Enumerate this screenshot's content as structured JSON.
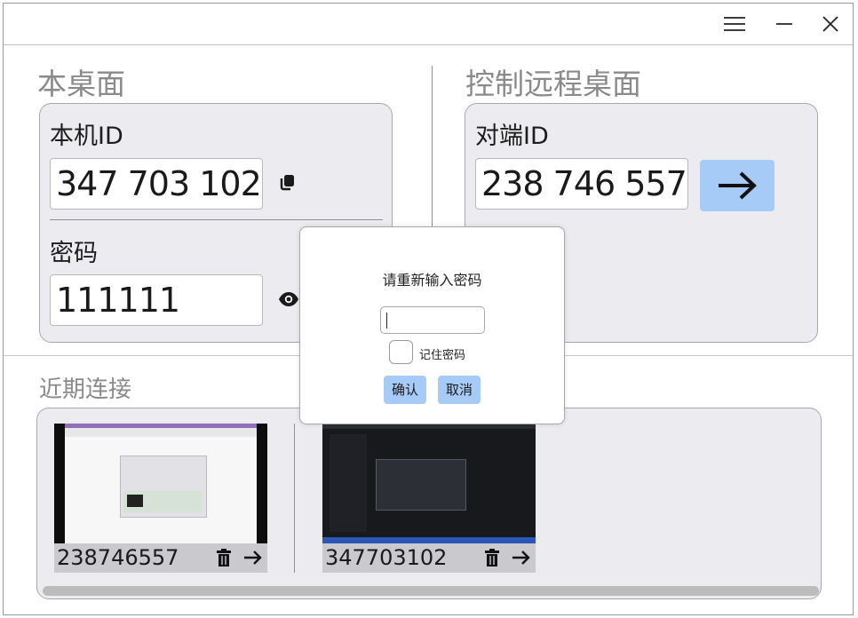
{
  "titlebar": {
    "menu_icon": "hamburger-menu-icon",
    "minimize_icon": "minimize-icon",
    "close_icon": "close-icon"
  },
  "local": {
    "section_title": "本桌面",
    "id_label": "本机ID",
    "id_value": "347 703 102",
    "copy_icon": "copy-icon",
    "password_label": "密码",
    "password_value": "111111",
    "eye_icon": "eye-icon"
  },
  "remote": {
    "section_title": "控制远程桌面",
    "id_label": "对端ID",
    "id_value": "238 746 557",
    "connect_icon": "arrow-right-icon"
  },
  "recent": {
    "section_title": "近期连接",
    "items": [
      {
        "id": "238746557",
        "delete_icon": "trash-icon",
        "connect_icon": "arrow-right-icon"
      },
      {
        "id": "347703102",
        "delete_icon": "trash-icon",
        "connect_icon": "arrow-right-icon"
      }
    ]
  },
  "dialog": {
    "title": "请重新输入密码",
    "input_value": "",
    "remember_label": "记住密码",
    "remember_checked": false,
    "confirm_label": "确认",
    "cancel_label": "取消"
  },
  "colors": {
    "accent": "#a7cbf7",
    "card_bg": "#ececf0",
    "section_title": "#8a8a8a"
  }
}
